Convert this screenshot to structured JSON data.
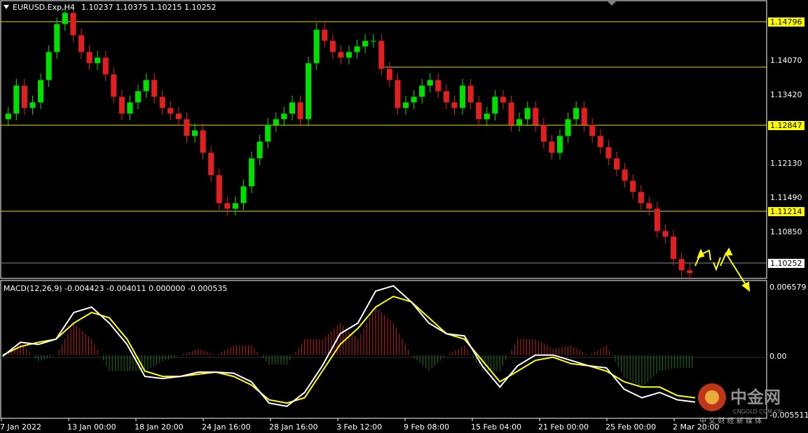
{
  "header": {
    "menu_icon": "triangle-down-icon",
    "symbol": "EURUSD.Exp,H4",
    "ohlc": "1.10237 1.10375 1.10215 1.10252"
  },
  "macd_header": "MACD(12,26,9) -0.004423 -0.004011 0.000000 -0.000535",
  "colors": {
    "background": "#000000",
    "bull_candle": "#00e000",
    "bear_candle": "#e02020",
    "level_line": "#e8e000",
    "current_line": "#8090a0",
    "macd_line": "#ffffff",
    "signal_line": "#ffff00",
    "hist_positive": "#c02020",
    "hist_negative": "#207020",
    "arrow": "#ffff00"
  },
  "price_axis": {
    "ticks": [
      "1.14070",
      "1.13420",
      "1.12130",
      "1.11490",
      "1.10850"
    ],
    "tagged_levels": [
      "1.14796",
      "1.12847",
      "1.11214"
    ],
    "current_price": "1.10252"
  },
  "macd_axis": {
    "ticks": [
      "0.006579",
      "0.00",
      "-0.005511"
    ]
  },
  "time_axis": [
    "7 Jan 2022",
    "13 Jan 00:00",
    "18 Jan 20:00",
    "24 Jan 16:00",
    "28 Jan 16:00",
    "3 Feb 12:00",
    "9 Feb 08:00",
    "15 Feb 04:00",
    "21 Feb 00:00",
    "25 Feb 00:00",
    "2 Mar 20:00"
  ],
  "watermark": {
    "logo_icon": "cngold-logo-icon",
    "name": "中金网",
    "domain": "CNGOLD.COM.CN",
    "slogan": "中 文 财 经 新 媒 体"
  },
  "chart_data": [
    {
      "type": "candlestick",
      "title": "EURUSD.Exp,H4",
      "ylim": [
        1.1018,
        1.1508
      ],
      "levels": [
        1.14796,
        1.14,
        1.12847,
        1.11214
      ],
      "current": 1.10252,
      "closes": [
        1.131,
        1.136,
        1.132,
        1.133,
        1.137,
        1.142,
        1.147,
        1.149,
        1.145,
        1.142,
        1.14,
        1.141,
        1.138,
        1.134,
        1.131,
        1.133,
        1.135,
        1.137,
        1.134,
        1.132,
        1.131,
        1.13,
        1.127,
        1.128,
        1.124,
        1.12,
        1.115,
        1.114,
        1.115,
        1.118,
        1.123,
        1.126,
        1.129,
        1.13,
        1.131,
        1.133,
        1.13,
        1.14,
        1.146,
        1.144,
        1.142,
        1.141,
        1.142,
        1.143,
        1.144,
        1.144,
        1.139,
        1.137,
        1.132,
        1.133,
        1.134,
        1.136,
        1.137,
        1.135,
        1.133,
        1.132,
        1.136,
        1.133,
        1.13,
        1.131,
        1.134,
        1.133,
        1.129,
        1.13,
        1.132,
        1.129,
        1.126,
        1.124,
        1.127,
        1.13,
        1.132,
        1.129,
        1.127,
        1.125,
        1.123,
        1.121,
        1.119,
        1.117,
        1.115,
        1.114,
        1.11,
        1.109,
        1.105,
        1.103,
        1.1025
      ]
    },
    {
      "type": "line",
      "title": "MACD(12,26,9)",
      "ylim": [
        -0.0058,
        0.0068
      ],
      "series": [
        {
          "name": "MACD",
          "values": [
            -0.0001,
            0.0012,
            0.001,
            0.0015,
            0.004,
            0.0045,
            0.003,
            0.001,
            -0.002,
            -0.0022,
            -0.002,
            -0.0016,
            -0.0016,
            -0.0017,
            -0.0025,
            -0.0045,
            -0.0048,
            -0.0035,
            -0.001,
            0.002,
            0.003,
            0.006,
            0.0065,
            0.005,
            0.003,
            0.002,
            0.0018,
            -0.001,
            -0.003,
            -0.001,
            0.0,
            0.0,
            -0.0005,
            -0.001,
            -0.0012,
            -0.0032,
            -0.004,
            -0.0035,
            -0.0042,
            -0.0044
          ]
        },
        {
          "name": "Signal",
          "values": [
            0.0,
            0.0008,
            0.0012,
            0.0015,
            0.003,
            0.004,
            0.0035,
            0.0015,
            -0.0015,
            -0.002,
            -0.002,
            -0.0018,
            -0.0016,
            -0.002,
            -0.0028,
            -0.0042,
            -0.0045,
            -0.004,
            -0.0015,
            0.001,
            0.0025,
            0.0045,
            0.0055,
            0.005,
            0.0035,
            0.002,
            0.0015,
            -0.0005,
            -0.0025,
            -0.0015,
            -0.0005,
            -0.0002,
            -0.0008,
            -0.001,
            -0.0015,
            -0.0025,
            -0.003,
            -0.003,
            -0.0038,
            -0.004
          ]
        }
      ]
    }
  ]
}
